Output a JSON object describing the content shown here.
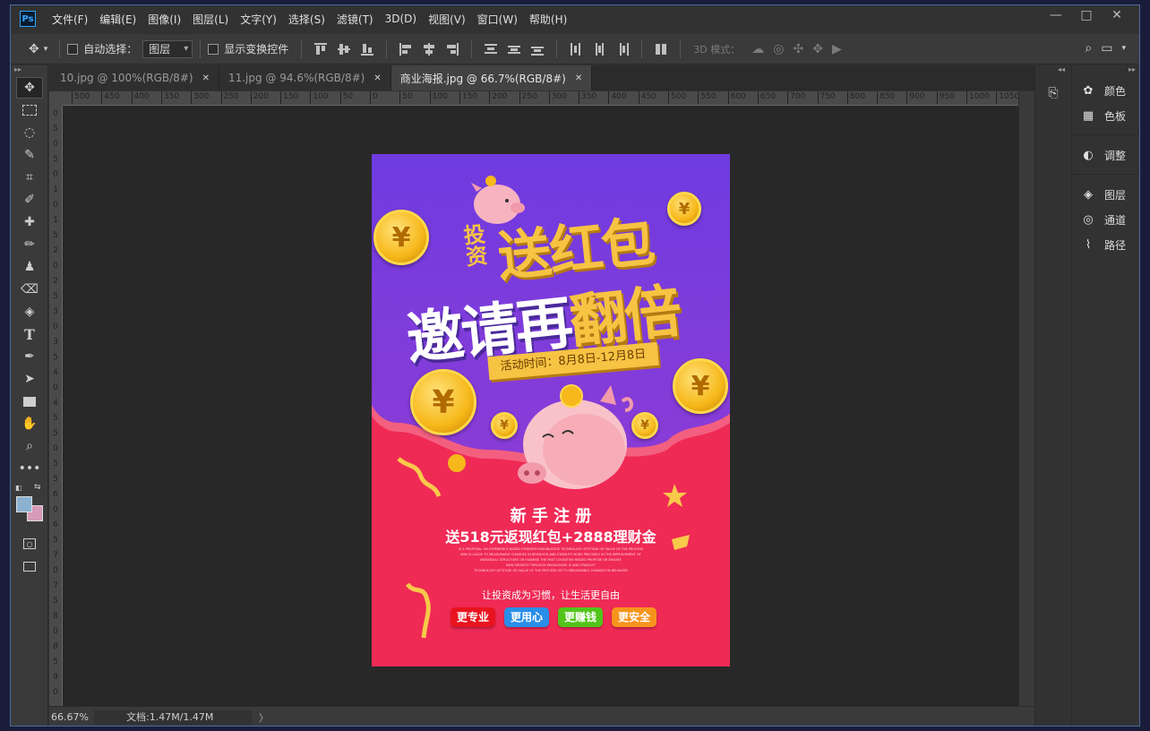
{
  "app": {
    "logo": "Ps",
    "menu": [
      "文件(F)",
      "编辑(E)",
      "图像(I)",
      "图层(L)",
      "文字(Y)",
      "选择(S)",
      "滤镜(T)",
      "3D(D)",
      "视图(V)",
      "窗口(W)",
      "帮助(H)"
    ],
    "window_controls": [
      "—",
      "□",
      "✕"
    ]
  },
  "options": {
    "auto_select_label": "自动选择：",
    "layer_select_value": "图层",
    "show_transform_label": "显示变换控件",
    "mode_3d_label": "3D 模式："
  },
  "tabs": [
    {
      "label": "10.jpg @ 100%(RGB/8#)",
      "close": "✕"
    },
    {
      "label": "11.jpg @ 94.6%(RGB/8#)",
      "close": "✕"
    },
    {
      "label": "商业海报.jpg @ 66.7%(RGB/8#)",
      "close": "✕"
    }
  ],
  "ruler_h": [
    "500",
    "450",
    "400",
    "350",
    "300",
    "250",
    "200",
    "150",
    "100",
    "50",
    "0",
    "50",
    "100",
    "150",
    "200",
    "250",
    "300",
    "350",
    "400",
    "450",
    "500",
    "550",
    "600",
    "650",
    "700",
    "750",
    "800",
    "850",
    "900",
    "950",
    "1000",
    "1050"
  ],
  "ruler_v": [
    "0",
    "5",
    "0",
    "5",
    "0",
    "1",
    "0",
    "1",
    "5",
    "2",
    "0",
    "2",
    "5",
    "3",
    "0",
    "3",
    "5",
    "4",
    "0",
    "4",
    "5",
    "5",
    "0",
    "5",
    "5",
    "6",
    "0",
    "6",
    "5",
    "7",
    "0",
    "7",
    "5",
    "8",
    "0",
    "8",
    "5",
    "9",
    "0"
  ],
  "status": {
    "zoom": "66.67%",
    "doc": "文档:1.47M/1.47M",
    "arrow": "〉"
  },
  "panels": [
    {
      "icon": "palette-icon",
      "glyph": "🎨",
      "label": "颜色"
    },
    {
      "icon": "swatches-icon",
      "glyph": "▦",
      "label": "色板"
    },
    {
      "icon": "adjustments-icon",
      "glyph": "◐",
      "label": "调整"
    },
    {
      "icon": "layers-icon",
      "glyph": "◈",
      "label": "图层"
    },
    {
      "icon": "channels-icon",
      "glyph": "◎",
      "label": "通道"
    },
    {
      "icon": "paths-icon",
      "glyph": "⌇",
      "label": "路径"
    }
  ],
  "poster": {
    "small_title": "投资",
    "title1": "送红包",
    "title2a": "邀请再",
    "title2b": "翻倍",
    "activity": "活动时间：8月8日-12月8日",
    "coin_symbol": "¥",
    "reg_title": "新 手 注 册",
    "reg_sub": "送518元返现红包+2888理财金",
    "fine_print": [
      "IS A PROPOSAL ON EXPERIENCE BASED STRENGTH KNOWLEDGE TECHNOLOGY ATTITUDE OR VALUE OF THE PROCESS",
      "WHICH LEADS TO MEASURABLE CHANGES IN BEHAVIOR AND STABILITY MORE PRECISELY IN THE IMPROVEMENT OF",
      "INDIVIDUAL STRUCTURE OR EXAMINE THE PAST COGNITIVE MODES PROPOSE OR ENSURE",
      "NEW GROWTH THROUGH KNOWLEDGE IS AND STABILITY",
      "TECHNOLOGY ATTITUDE OR VALUE OF THE PROCESS OR TO MEASURABLE CHANGES IN BEHAVIOR"
    ],
    "slogan": "让投资成为习惯，让生活更自由",
    "tags": [
      {
        "label": "更专业",
        "color": "#e8141f"
      },
      {
        "label": "更用心",
        "color": "#2a8ee8"
      },
      {
        "label": "更赚钱",
        "color": "#52c41a"
      },
      {
        "label": "更安全",
        "color": "#f7941d"
      }
    ]
  }
}
